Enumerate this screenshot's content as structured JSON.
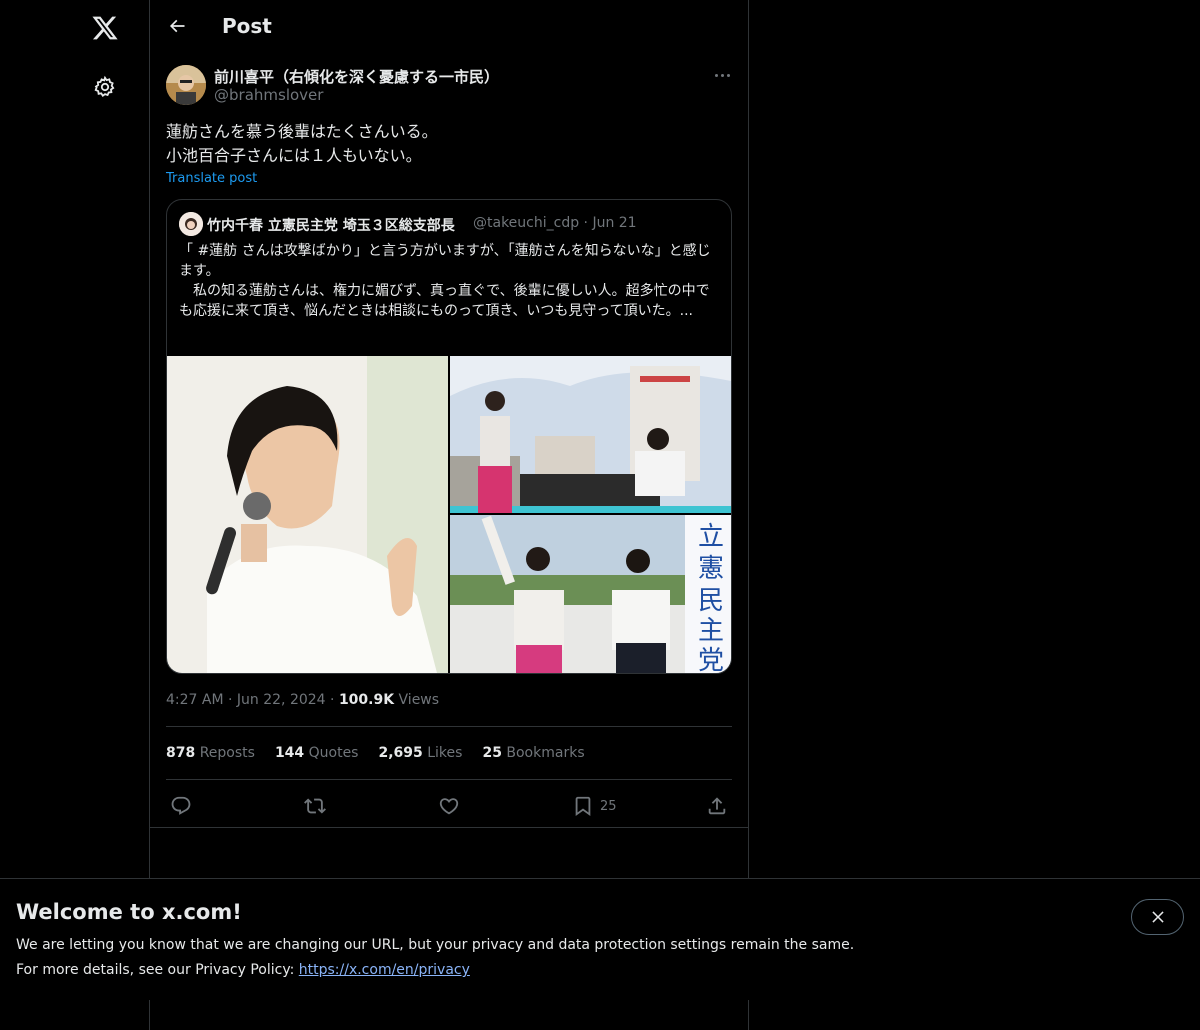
{
  "header": {
    "title": "Post"
  },
  "post": {
    "author_name": "前川喜平（右傾化を深く憂慮する一市民）",
    "author_handle": "@brahmslover",
    "text_line1": "蓮舫さんを慕う後輩はたくさんいる。",
    "text_line2": "小池百合子さんには１人もいない。",
    "translate": "Translate post",
    "quote": {
      "author_name": "竹内千春 立憲民主党 埼玉３区総支部長",
      "author_handle": "@takeuchi_cdp",
      "date": "Jun 21",
      "text": "「 #蓮舫 さんは攻撃ばかり」と言う方がいますが、「蓮舫さんを知らないな」と感じます。\n　私の知る蓮舫さんは、権力に媚びず、真っ直ぐで、後輩に優しい人。超多忙の中でも応援に来て頂き、悩んだときは相談にものって頂き、いつも見守って頂いた。..."
    },
    "time": "4:27 AM",
    "date": "Jun 22, 2024",
    "views_count": "100.9K",
    "views_label": "Views",
    "reposts_count": "878",
    "reposts_label": "Reposts",
    "quotes_count": "144",
    "quotes_label": "Quotes",
    "likes_count": "2,695",
    "likes_label": "Likes",
    "bookmarks_count": "25",
    "bookmarks_label": "Bookmarks",
    "bookmark_action_count": "25"
  },
  "banner": {
    "title": "Welcome to x.com!",
    "line1": "We are letting you know that we are changing our URL, but your privacy and data protection settings remain the same.",
    "line2_prefix": "For more details, see our Privacy Policy: ",
    "link": "https://x.com/en/privacy"
  },
  "icons": {
    "logo": "x-logo-icon",
    "settings": "gear-icon",
    "back": "arrow-left-icon",
    "more": "more-horizontal-icon",
    "reply": "reply-icon",
    "repost": "repost-icon",
    "like": "heart-icon",
    "bookmark": "bookmark-icon",
    "share": "share-icon",
    "close": "close-icon"
  }
}
